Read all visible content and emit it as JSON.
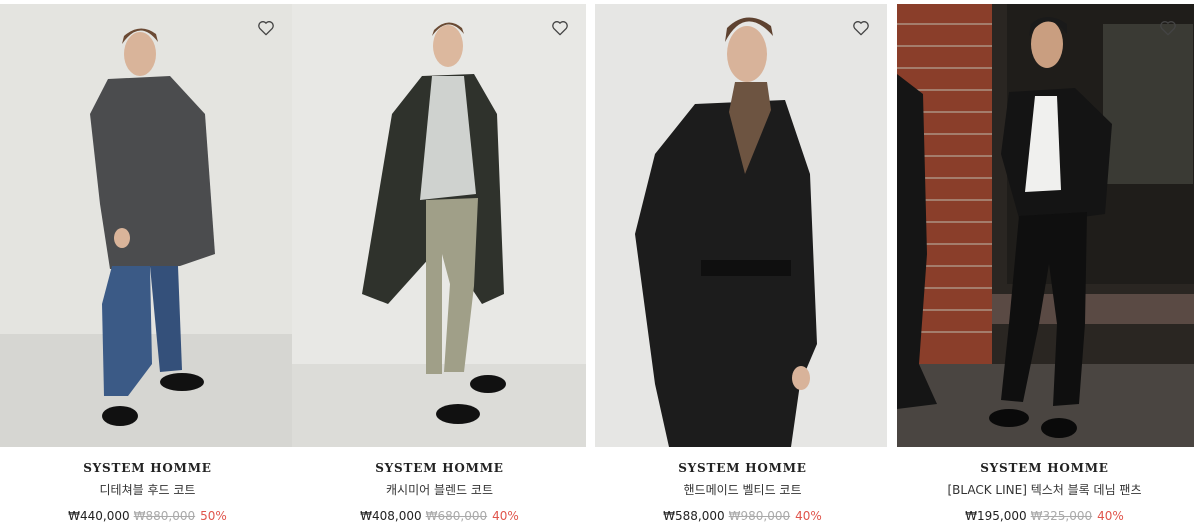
{
  "products": [
    {
      "brand": "SYSTEM HOMME",
      "name": "디테쳐블 후드 코트",
      "price": "₩440,000",
      "original_price": "₩880,000",
      "discount": "50%",
      "photo_icon": "product-photo-hooded-coat"
    },
    {
      "brand": "SYSTEM HOMME",
      "name": "캐시미어 블렌드 코트",
      "price": "₩408,000",
      "original_price": "₩680,000",
      "discount": "40%",
      "photo_icon": "product-photo-cashmere-coat"
    },
    {
      "brand": "SYSTEM HOMME",
      "name": "핸드메이드 벨티드 코트",
      "price": "₩588,000",
      "original_price": "₩980,000",
      "discount": "40%",
      "photo_icon": "product-photo-belted-coat"
    },
    {
      "brand": "SYSTEM HOMME",
      "name": "[BLACK LINE] 텍스처 블록 데님 팬츠",
      "price": "₩195,000",
      "original_price": "₩325,000",
      "discount": "40%",
      "photo_icon": "product-photo-denim-pants"
    }
  ],
  "colors": {
    "discount": "#e0554c",
    "original_price": "#aaaaaa",
    "text": "#222222"
  }
}
